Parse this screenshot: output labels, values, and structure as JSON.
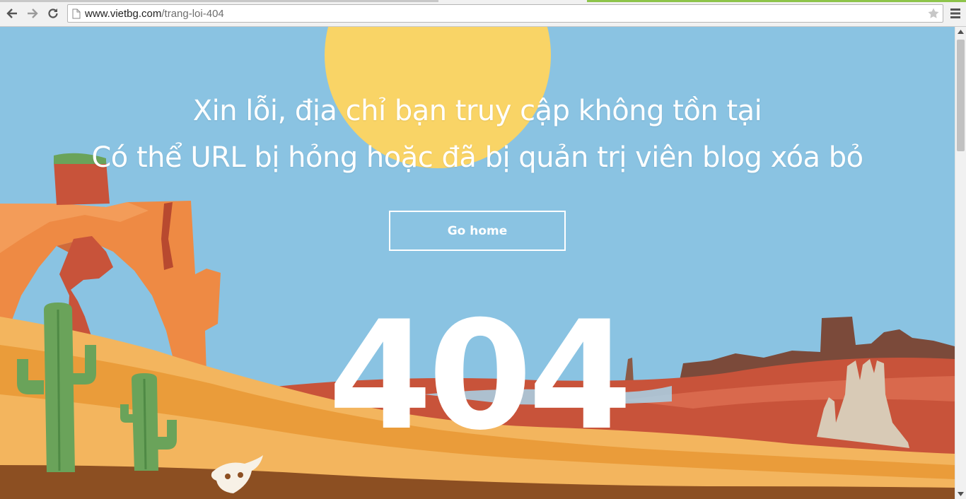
{
  "browser": {
    "url_host": "www.vietbg.com",
    "url_path": "/trang-loi-404",
    "back_icon": "back-arrow-icon",
    "forward_icon": "forward-arrow-icon",
    "reload_icon": "reload-icon",
    "bookmark_icon": "star-icon",
    "menu_icon": "hamburger-menu-icon"
  },
  "page": {
    "headline_line1": "Xin lỗi, địa chỉ bạn truy cập không tồn tại",
    "headline_line2": "Có thể URL bị hỏng hoặc đã bị quản trị viên blog xóa bỏ",
    "button_label": "Go home",
    "error_code": "404"
  },
  "colors": {
    "sky": "#8ac3e2",
    "sun": "#f9d466",
    "sand_light": "#f3b55e",
    "sand_dark": "#ea9c3a",
    "rock_orange": "#ee8a44",
    "rock_red": "#c8533a",
    "mesa_brown": "#7b4a3a",
    "cactus_green": "#6aa35a",
    "ground_brown": "#8c4f22"
  }
}
